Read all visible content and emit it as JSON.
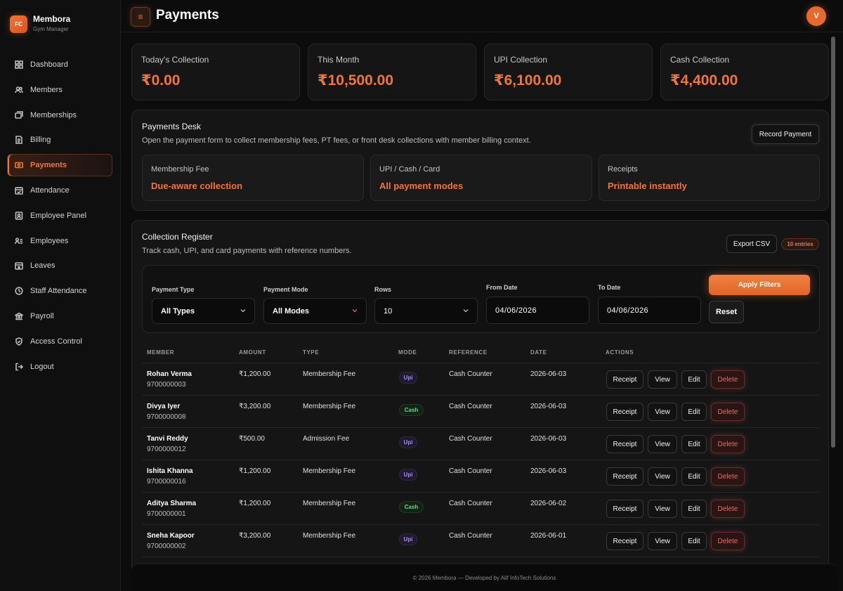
{
  "brand": {
    "logo": "FC",
    "name": "Membora",
    "subtitle": "Gym Manager"
  },
  "sidebar": {
    "items": [
      {
        "label": "Dashboard",
        "icon": "grid-icon"
      },
      {
        "label": "Members",
        "icon": "users-icon"
      },
      {
        "label": "Memberships",
        "icon": "cards-icon"
      },
      {
        "label": "Billing",
        "icon": "document-icon"
      },
      {
        "label": "Payments",
        "icon": "money-icon",
        "active": true
      },
      {
        "label": "Attendance",
        "icon": "calendar-check-icon"
      },
      {
        "label": "Employee Panel",
        "icon": "id-card-icon"
      },
      {
        "label": "Employees",
        "icon": "user-list-icon"
      },
      {
        "label": "Leaves",
        "icon": "calendar-x-icon"
      },
      {
        "label": "Staff Attendance",
        "icon": "clock-icon"
      },
      {
        "label": "Payroll",
        "icon": "bank-icon"
      },
      {
        "label": "Access Control",
        "icon": "shield-icon"
      },
      {
        "label": "Logout",
        "icon": "logout-icon"
      }
    ]
  },
  "header": {
    "menu_icon": "≡",
    "title": "Payments",
    "avatar_initial": "V"
  },
  "stats": [
    {
      "label": "Today's Collection",
      "value": "₹0.00"
    },
    {
      "label": "This Month",
      "value": "₹10,500.00"
    },
    {
      "label": "UPI Collection",
      "value": "₹6,100.00"
    },
    {
      "label": "Cash Collection",
      "value": "₹4,400.00"
    }
  ],
  "desk": {
    "title": "Payments Desk",
    "description": "Open the payment form to collect membership fees, PT fees, or front desk collections with member billing context.",
    "record_button": "Record Payment",
    "features": [
      {
        "label": "Membership Fee",
        "value": "Due-aware collection"
      },
      {
        "label": "UPI / Cash / Card",
        "value": "All payment modes"
      },
      {
        "label": "Receipts",
        "value": "Printable instantly"
      }
    ]
  },
  "register": {
    "title": "Collection Register",
    "description": "Track cash, UPI, and card payments with reference numbers.",
    "export_button": "Export CSV",
    "entries_badge": "10 entries",
    "filters": {
      "payment_type_label": "Payment Type",
      "payment_type_value": "All Types",
      "payment_mode_label": "Payment Mode",
      "payment_mode_value": "All Modes",
      "rows_label": "Rows",
      "rows_value": "10",
      "from_label": "From Date",
      "from_value": "04/06/2026",
      "to_label": "To Date",
      "to_value": "04/06/2026",
      "apply_button": "Apply Filters",
      "reset_button": "Reset"
    },
    "columns": [
      "MEMBER",
      "AMOUNT",
      "TYPE",
      "MODE",
      "REFERENCE",
      "DATE",
      "ACTIONS"
    ],
    "actions": {
      "receipt": "Receipt",
      "view": "View",
      "edit": "Edit",
      "delete": "Delete"
    },
    "rows": [
      {
        "name": "Rohan Verma",
        "phone": "9700000003",
        "amount": "₹1,200.00",
        "type": "Membership Fee",
        "mode": "Upi",
        "reference": "Cash Counter",
        "date": "2026-06-03"
      },
      {
        "name": "Divya Iyer",
        "phone": "9700000008",
        "amount": "₹3,200.00",
        "type": "Membership Fee",
        "mode": "Cash",
        "reference": "Cash Counter",
        "date": "2026-06-03"
      },
      {
        "name": "Tanvi Reddy",
        "phone": "9700000012",
        "amount": "₹500.00",
        "type": "Admission Fee",
        "mode": "Upi",
        "reference": "Cash Counter",
        "date": "2026-06-03"
      },
      {
        "name": "Ishita Khanna",
        "phone": "9700000016",
        "amount": "₹1,200.00",
        "type": "Membership Fee",
        "mode": "Upi",
        "reference": "Cash Counter",
        "date": "2026-06-03"
      },
      {
        "name": "Aditya Sharma",
        "phone": "9700000001",
        "amount": "₹1,200.00",
        "type": "Membership Fee",
        "mode": "Cash",
        "reference": "Cash Counter",
        "date": "2026-06-02"
      },
      {
        "name": "Sneha Kapoor",
        "phone": "9700000002",
        "amount": "₹3,200.00",
        "type": "Membership Fee",
        "mode": "Upi",
        "reference": "Cash Counter",
        "date": "2026-06-01"
      }
    ]
  },
  "footer": {
    "text": "© 2026 Membora — Developed by Alif InfoTech Solutions"
  },
  "colors": {
    "accent": "#f0763a",
    "upi": "#a88bf0",
    "cash": "#6fd48a",
    "danger": "#e76a6a"
  }
}
